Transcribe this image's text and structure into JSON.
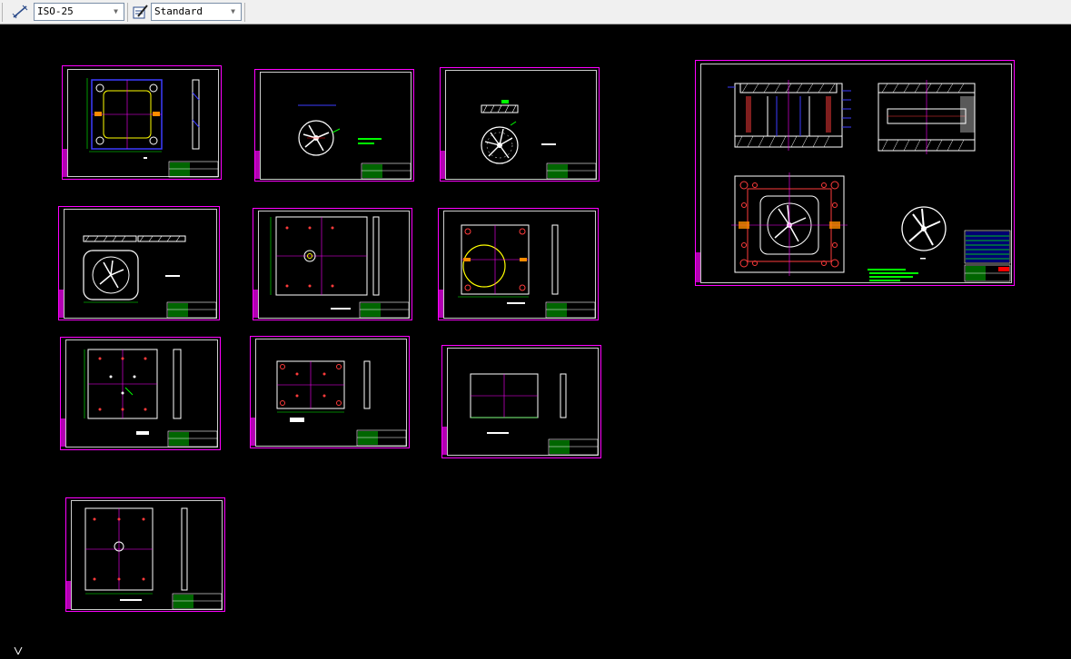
{
  "toolbar": {
    "dimstyle_icon": "dimension-style-icon",
    "dimstyle_value": "ISO-25",
    "textstyle_icon": "text-style-icon",
    "textstyle_value": "Standard"
  },
  "drawing": {
    "sheets": [
      {
        "id": "sheet-1",
        "part": "plate-with-window"
      },
      {
        "id": "sheet-2",
        "part": "fan-impeller-small"
      },
      {
        "id": "sheet-3",
        "part": "fan-impeller-section"
      },
      {
        "id": "sheet-4",
        "part": "cavity-insert"
      },
      {
        "id": "sheet-5",
        "part": "plate-center-hole"
      },
      {
        "id": "sheet-6",
        "part": "plate-round-window"
      },
      {
        "id": "sheet-7",
        "part": "plate-holes-pattern"
      },
      {
        "id": "sheet-8",
        "part": "plate-small"
      },
      {
        "id": "sheet-9",
        "part": "plate-plain"
      },
      {
        "id": "sheet-10",
        "part": "plate-tall"
      },
      {
        "id": "sheet-assembly",
        "part": "mold-assembly"
      }
    ],
    "colors": {
      "frame": "#ff00ff",
      "geometry": "#ffffff",
      "dimension": "#00ff00",
      "section": "#ff3b3b",
      "blue": "#3c3cff"
    },
    "ucs_icon": "ucs-icon"
  }
}
